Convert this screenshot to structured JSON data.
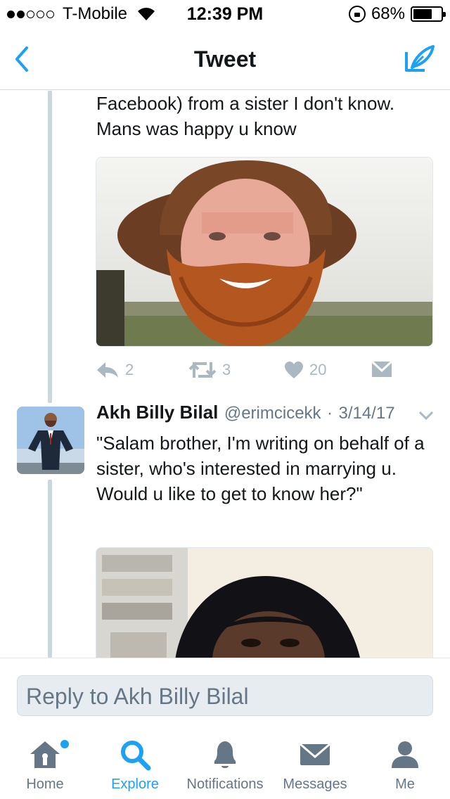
{
  "status_bar": {
    "carrier": "T-Mobile",
    "time": "12:39 PM",
    "battery": "68%",
    "battery_level": 0.68
  },
  "nav": {
    "title": "Tweet"
  },
  "tweet1": {
    "text_fragment": "Facebook) from a sister I don't know. Mans was happy u know",
    "replies": "2",
    "retweets": "3",
    "likes": "20"
  },
  "tweet2": {
    "author_name": "Akh Billy Bilal",
    "handle": "@erimcicekk",
    "separator": "·",
    "date": "3/14/17",
    "text": "\"Salam brother, I'm writing on behalf of a sister, who's interested in marrying u. Would u like to get to know her?\""
  },
  "reply": {
    "placeholder": "Reply to Akh Billy Bilal"
  },
  "tabs": [
    {
      "label": "Home",
      "icon": "home-icon",
      "active": false
    },
    {
      "label": "Explore",
      "icon": "search-icon",
      "active": true
    },
    {
      "label": "Notifications",
      "icon": "bell-icon",
      "active": false
    },
    {
      "label": "Messages",
      "icon": "envelope-icon",
      "active": false
    },
    {
      "label": "Me",
      "icon": "person-icon",
      "active": false
    }
  ],
  "colors": {
    "accent": "#1da1f2",
    "muted": "#aab8c2",
    "text": "#14171a",
    "secondary": "#657786"
  }
}
